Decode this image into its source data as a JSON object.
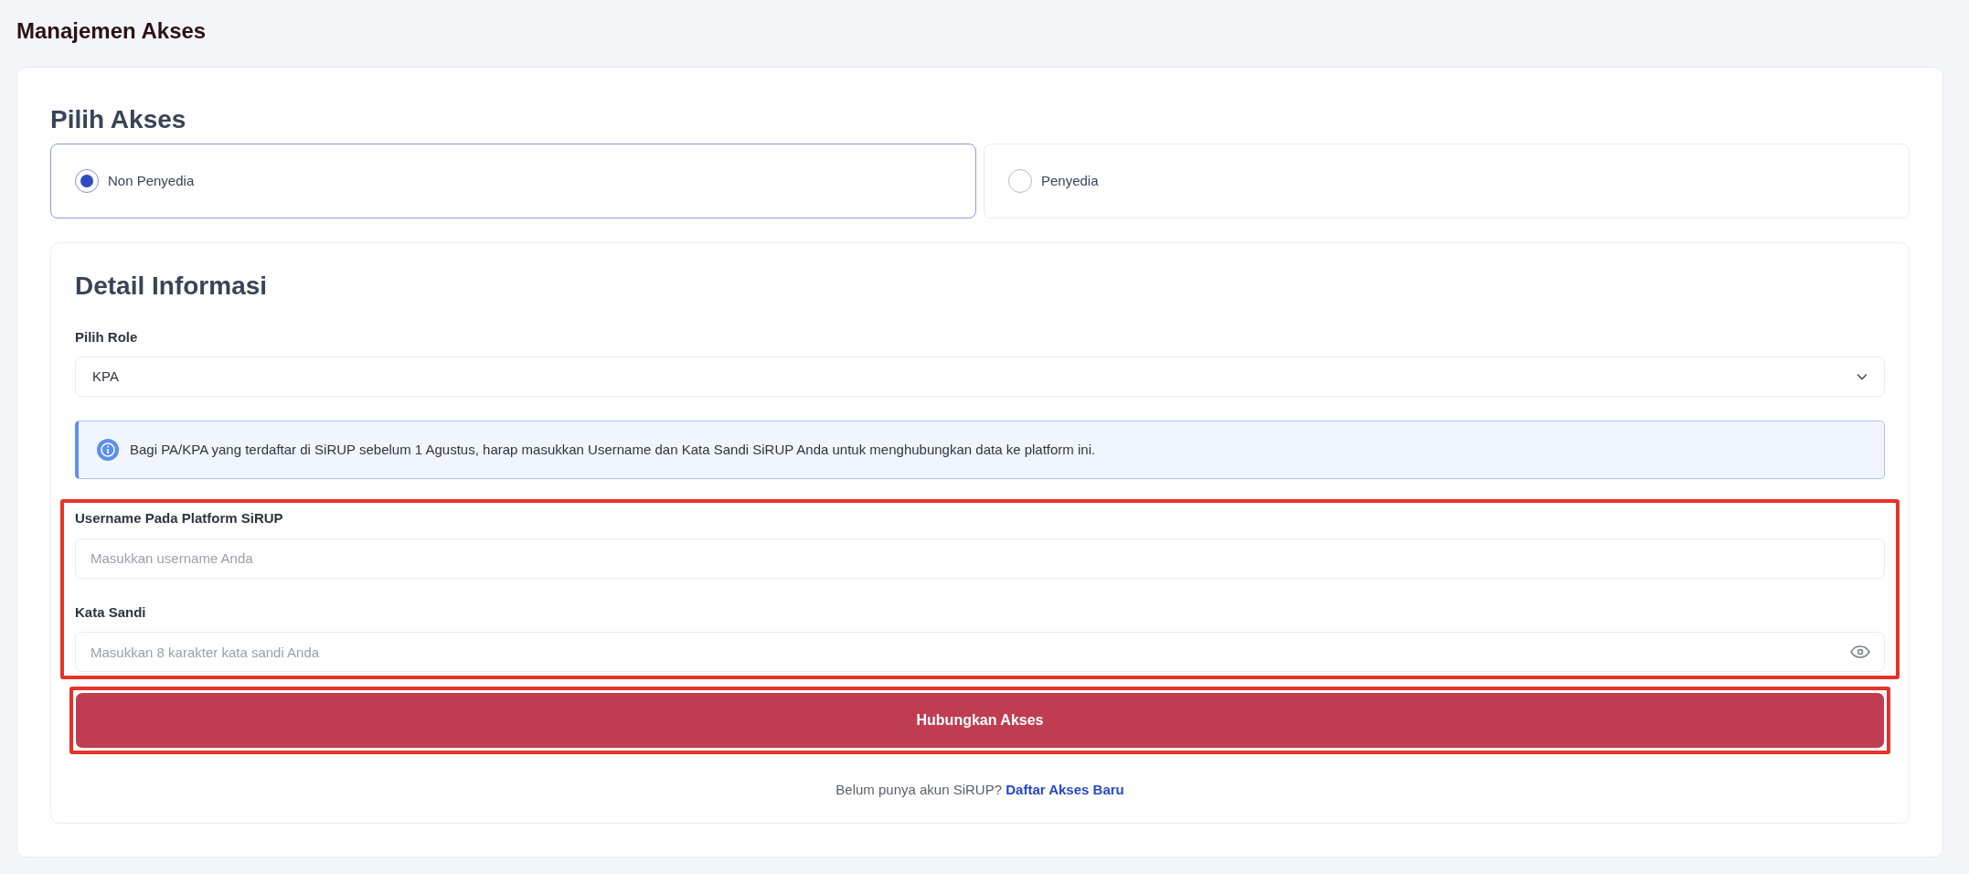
{
  "page_title": "Manajemen Akses",
  "access": {
    "heading": "Pilih Akses",
    "options": [
      {
        "label": "Non Penyedia",
        "selected": true
      },
      {
        "label": "Penyedia",
        "selected": false
      }
    ]
  },
  "detail": {
    "heading": "Detail Informasi",
    "role": {
      "label": "Pilih Role",
      "value": "KPA"
    },
    "info": "Bagi PA/KPA yang terdaftar di SiRUP sebelum 1 Agustus, harap masukkan Username dan Kata Sandi SiRUP Anda untuk menghubungkan data ke platform ini.",
    "credentials": {
      "highlighted": true,
      "fields": [
        {
          "kind": "text",
          "label": "Username Pada Platform SiRUP",
          "placeholder": "Masukkan username Anda"
        },
        {
          "kind": "password",
          "label": "Kata Sandi",
          "placeholder": "Masukkan 8 karakter kata sandi Anda"
        }
      ]
    },
    "submit": {
      "label": "Hubungkan Akses",
      "highlighted": true
    },
    "footer": {
      "text": "Belum punya akun SiRUP?",
      "link": "Daftar Akses Baru"
    }
  }
}
